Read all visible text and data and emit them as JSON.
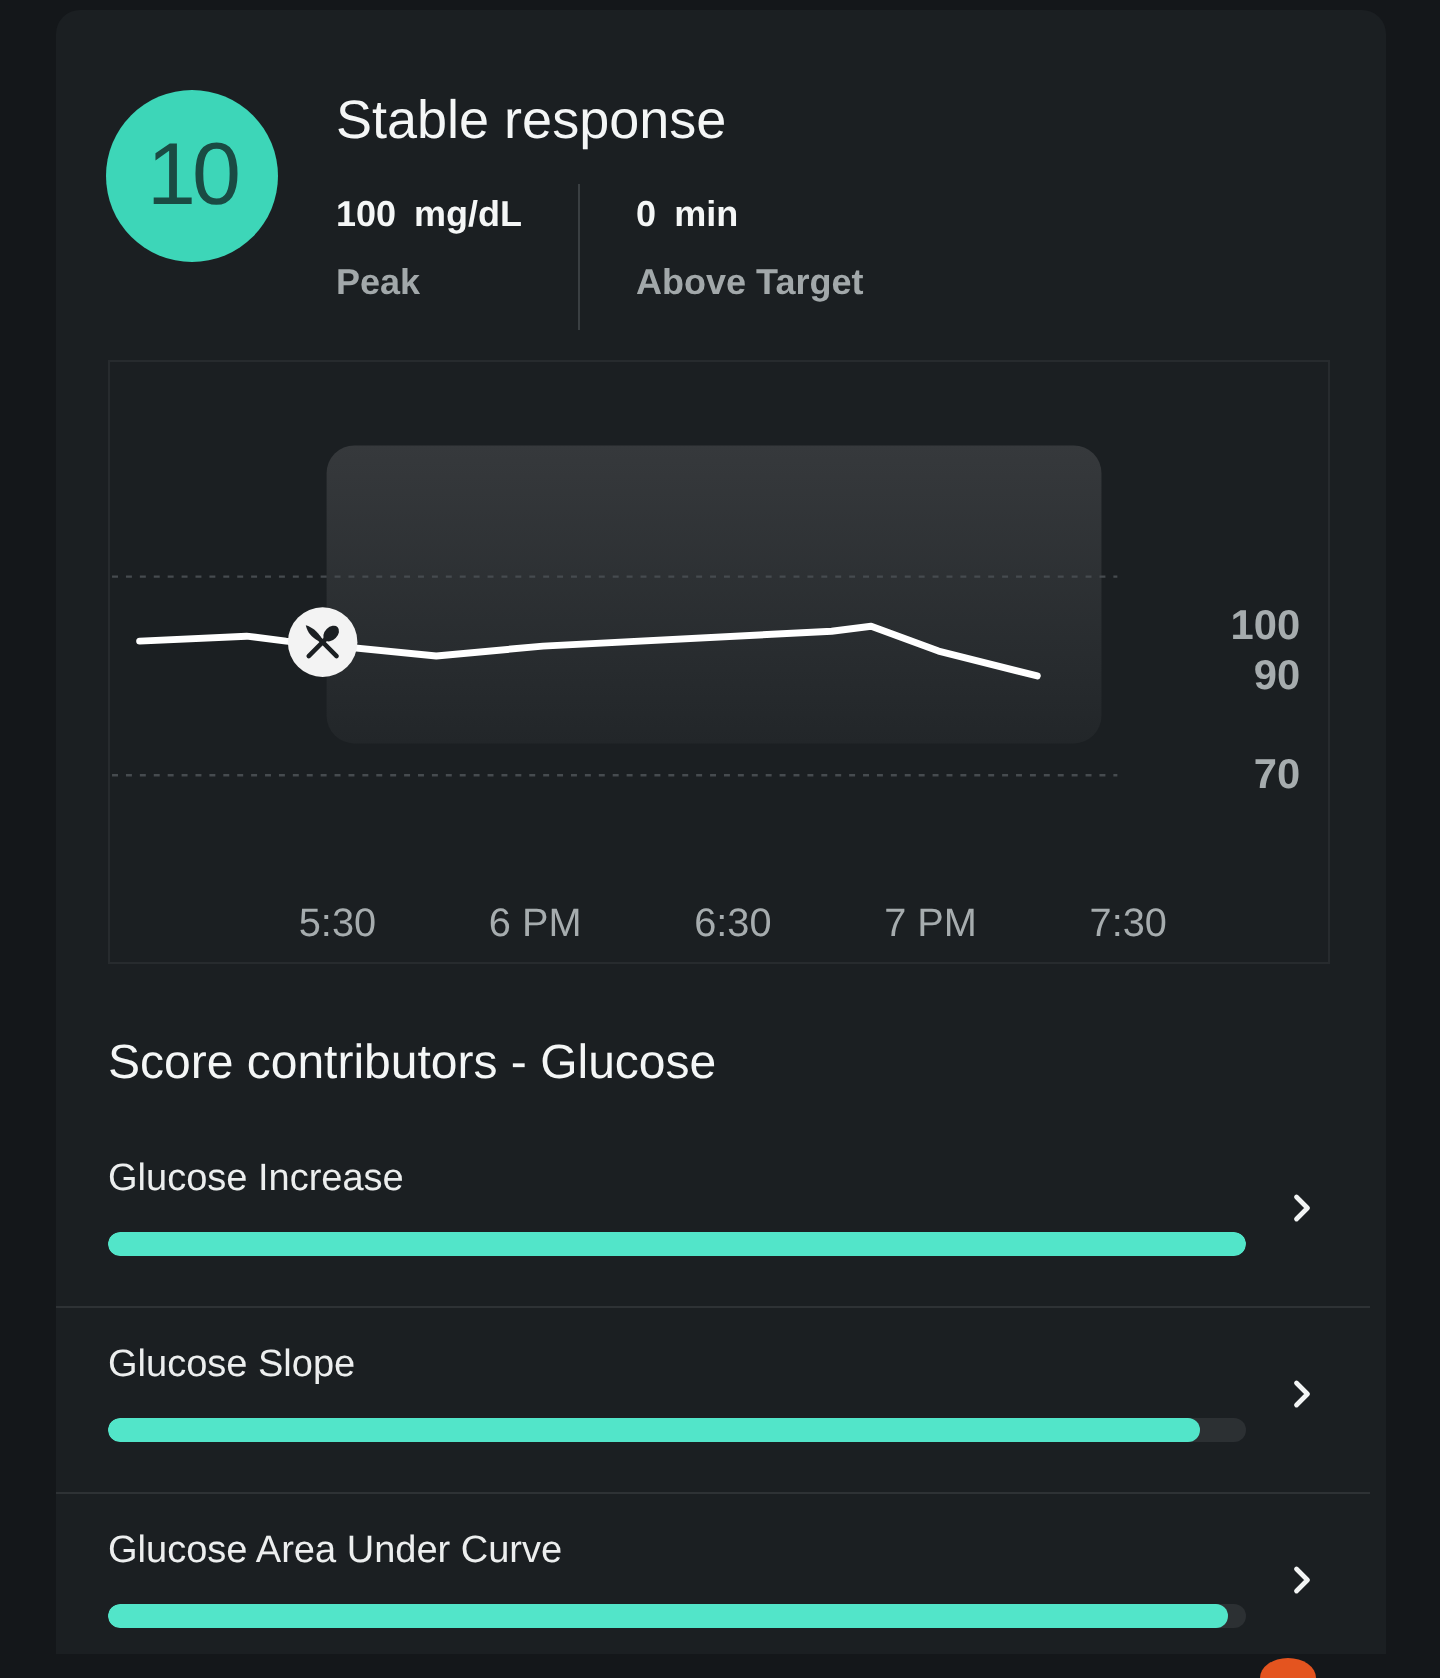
{
  "header": {
    "score": "10",
    "title": "Stable response",
    "stats": [
      {
        "value": "100",
        "unit": "mg/dL",
        "label": "Peak"
      },
      {
        "value": "0",
        "unit": "min",
        "label": "Above Target"
      }
    ]
  },
  "chart": {
    "chart_data": {
      "type": "line",
      "x": [
        5.0,
        5.27,
        5.37,
        5.75,
        6.02,
        6.75,
        6.85,
        7.02,
        7.27
      ],
      "series": [
        {
          "color": "#ffffff",
          "values": [
            97,
            98,
            97,
            94,
            96,
            99,
            100,
            95,
            90
          ]
        }
      ],
      "xlim": [
        4.93,
        8.0
      ],
      "ylim": [
        32.4,
        153.2
      ],
      "xticks": [
        {
          "value": 5.5,
          "label": "5:30"
        },
        {
          "value": 6,
          "label": "6 PM"
        },
        {
          "value": 6.5,
          "label": "6:30"
        },
        {
          "value": 7,
          "label": "7 PM"
        },
        {
          "value": 7.5,
          "label": "7:30"
        }
      ],
      "yticks": [
        70,
        90,
        100
      ]
    }
  },
  "contributors": {
    "title": "Score contributors - Glucose",
    "items": [
      {
        "label": "Glucose Increase",
        "level": 1.0
      },
      {
        "label": "Glucose Slope",
        "level": 0.96
      },
      {
        "label": "Glucose Area Under Curve",
        "level": 0.985
      }
    ]
  }
}
